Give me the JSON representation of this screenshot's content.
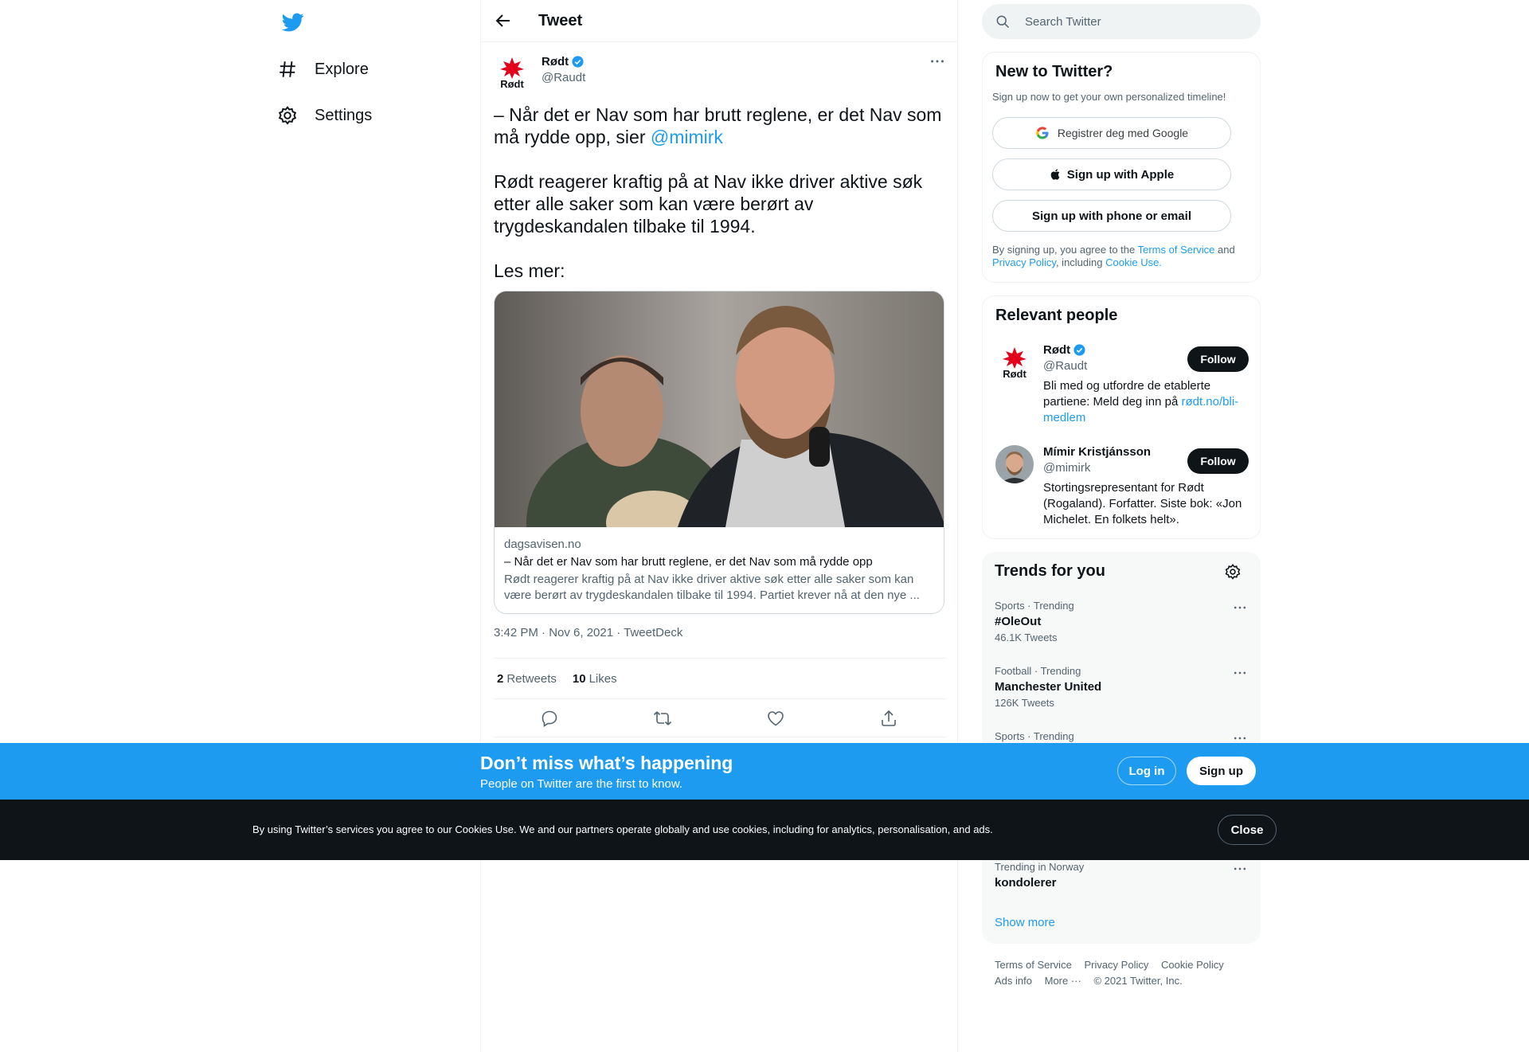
{
  "nav": {
    "explore_label": "Explore",
    "settings_label": "Settings"
  },
  "header": {
    "title": "Tweet"
  },
  "tweet": {
    "author_name": "Rødt",
    "author_handle": "@Raudt",
    "avatar_text": "Rødt",
    "text_line1": "– Når det er Nav som har brutt reglene, er det Nav som må rydde opp, sier ",
    "mention": "@mimirk",
    "text_para2": "Rødt reagerer kraftig på at Nav ikke driver aktive søk etter alle saker som kan være berørt av trygdeskandalen tilbake til 1994.",
    "text_para3": "Les mer:",
    "card": {
      "domain": "dagsavisen.no",
      "title": "– Når det er Nav som har brutt reglene, er det Nav som må rydde opp",
      "description": "Rødt reagerer kraftig på at Nav ikke driver aktive søk etter alle saker som kan være berørt av trygdeskandalen tilbake til 1994. Partiet krever nå at den nye ..."
    },
    "timestamp": "3:42 PM · Nov 6, 2021 · TweetDeck",
    "retweets_count": "2",
    "retweets_label": "Retweets",
    "likes_count": "10",
    "likes_label": "Likes"
  },
  "search": {
    "placeholder": "Search Twitter"
  },
  "signup": {
    "title": "New to Twitter?",
    "subtitle": "Sign up now to get your own personalized timeline!",
    "google_label": "Registrer deg med Google",
    "apple_label": "Sign up with Apple",
    "phone_label": "Sign up with phone or email",
    "legal_prefix": "By signing up, you agree to the ",
    "terms": "Terms of Service",
    "and": " and ",
    "privacy": "Privacy Policy",
    "including": ", including ",
    "cookie": "Cookie Use."
  },
  "relevant": {
    "title": "Relevant people",
    "people": [
      {
        "name": "Rødt",
        "handle": "@Raudt",
        "bio_text": "Bli med og utfordre de etablerte partiene: Meld deg inn på ",
        "bio_link": "rødt.no/bli-medlem",
        "follow": "Follow",
        "avatar_text": "Rødt"
      },
      {
        "name": "Mímir Kristjánsson",
        "handle": "@mimirk",
        "bio_text": "Stortingsrepresentant for Rødt (Rogaland). Forfatter. Siste bok: «Jon Michelet. En folkets helt».",
        "follow": "Follow"
      }
    ]
  },
  "trends": {
    "title": "Trends for you",
    "items": [
      {
        "meta": "Sports · Trending",
        "name": "#OleOut",
        "count": "46.1K Tweets"
      },
      {
        "meta": "Football · Trending",
        "name": "Manchester United",
        "count": "126K Tweets"
      },
      {
        "meta": "Sports · Trending",
        "name": "",
        "count": ""
      },
      {
        "meta": "Trending in Norway",
        "name": "kondolerer",
        "count": ""
      }
    ],
    "show_more": "Show more"
  },
  "footer": {
    "terms": "Terms of Service",
    "privacy": "Privacy Policy",
    "cookie": "Cookie Policy",
    "ads": "Ads info",
    "more": "More ···",
    "copyright": "© 2021 Twitter, Inc."
  },
  "banner": {
    "title": "Don’t miss what’s happening",
    "subtitle": "People on Twitter are the first to know.",
    "login": "Log in",
    "signup": "Sign up"
  },
  "cookies": {
    "text": "By using Twitter’s services you agree to our Cookies Use. We and our partners operate globally and use cookies, including for analytics, personalisation, and ads.",
    "close": "Close"
  },
  "colors": {
    "brand_blue": "#1d9bf0",
    "dark": "#0f1419",
    "muted": "#536471",
    "rodt_red": "#e2001a"
  }
}
